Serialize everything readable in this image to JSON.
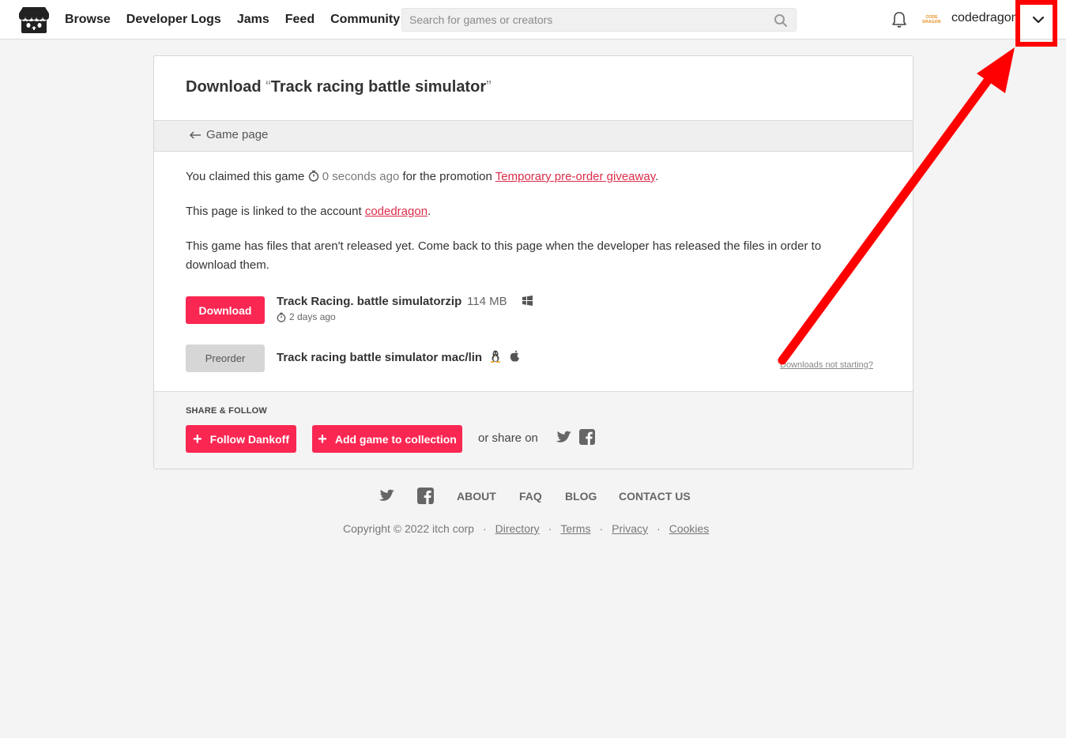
{
  "header": {
    "nav": [
      "Browse",
      "Developer Logs",
      "Jams",
      "Feed",
      "Community"
    ],
    "search_placeholder": "Search for games or creators",
    "username": "codedragon",
    "avatar_text": [
      "CODE",
      "DRAGON"
    ]
  },
  "card": {
    "title_prefix": "Download",
    "open_quote": "“",
    "game_title": "Track racing battle simulator",
    "close_quote": "”",
    "back_label": "Game page",
    "claim_text": "You claimed this game",
    "claim_time": "0 seconds ago",
    "claim_for": "for the promotion",
    "promotion_link": "Temporary pre-order giveaway",
    "claim_end": ".",
    "linked_text": "This page is linked to the account",
    "account_link": "codedragon",
    "linked_end": ".",
    "unreleased_text": "This game has files that aren't released yet. Come back to this page when the developer has released the files in order to download them.",
    "files": [
      {
        "button": "Download",
        "name": "Track Racing. battle simulatorzip",
        "size": "114 MB",
        "date": "2 days ago",
        "platforms": [
          "windows-icon"
        ]
      },
      {
        "button": "Preorder",
        "name": "Track racing battle simulator mac/lin",
        "platforms": [
          "linux-icon",
          "apple-icon"
        ]
      }
    ],
    "downloads_help": "Downloads not starting?",
    "share_title": "SHARE & FOLLOW",
    "follow_label": "Follow Dankoff",
    "collection_label": "Add game to collection",
    "or_share": "or share on"
  },
  "footer": {
    "links": [
      "ABOUT",
      "FAQ",
      "BLOG",
      "CONTACT US"
    ],
    "copyright": "Copyright © 2022 itch corp",
    "sep": "·",
    "legal_links": [
      "Directory",
      "Terms",
      "Privacy",
      "Cookies"
    ]
  },
  "colors": {
    "accent": "#fa2752",
    "link": "#da2c49",
    "annotation": "#ff0000"
  }
}
